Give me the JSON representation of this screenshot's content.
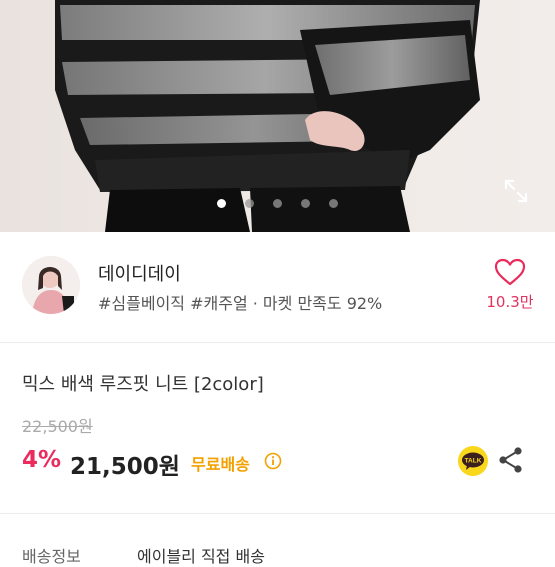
{
  "carousel": {
    "slide_count": 5,
    "active_index": 0
  },
  "store": {
    "name": "데이디데이",
    "tags": "#심플베이직 #캐주얼 · 마켓 만족도 92%",
    "likes": "10.3만"
  },
  "product": {
    "title": "믹스 배색 루즈핏 니트 [2color]",
    "original_price": "22,500원",
    "discount": "4%",
    "price": "21,500원",
    "shipping_badge": "무료배송"
  },
  "icons": {
    "expand": "expand-icon",
    "heart": "heart-icon",
    "info": "info-icon",
    "talk": "kakao-talk-icon",
    "share": "share-icon"
  },
  "colors": {
    "accent_pink": "#ea2b5b",
    "shipping_orange": "#f4a100",
    "talk_yellow": "#f9d71c"
  },
  "shipping_row": {
    "label": "배송정보",
    "value": "에이블리 직접 배송"
  }
}
